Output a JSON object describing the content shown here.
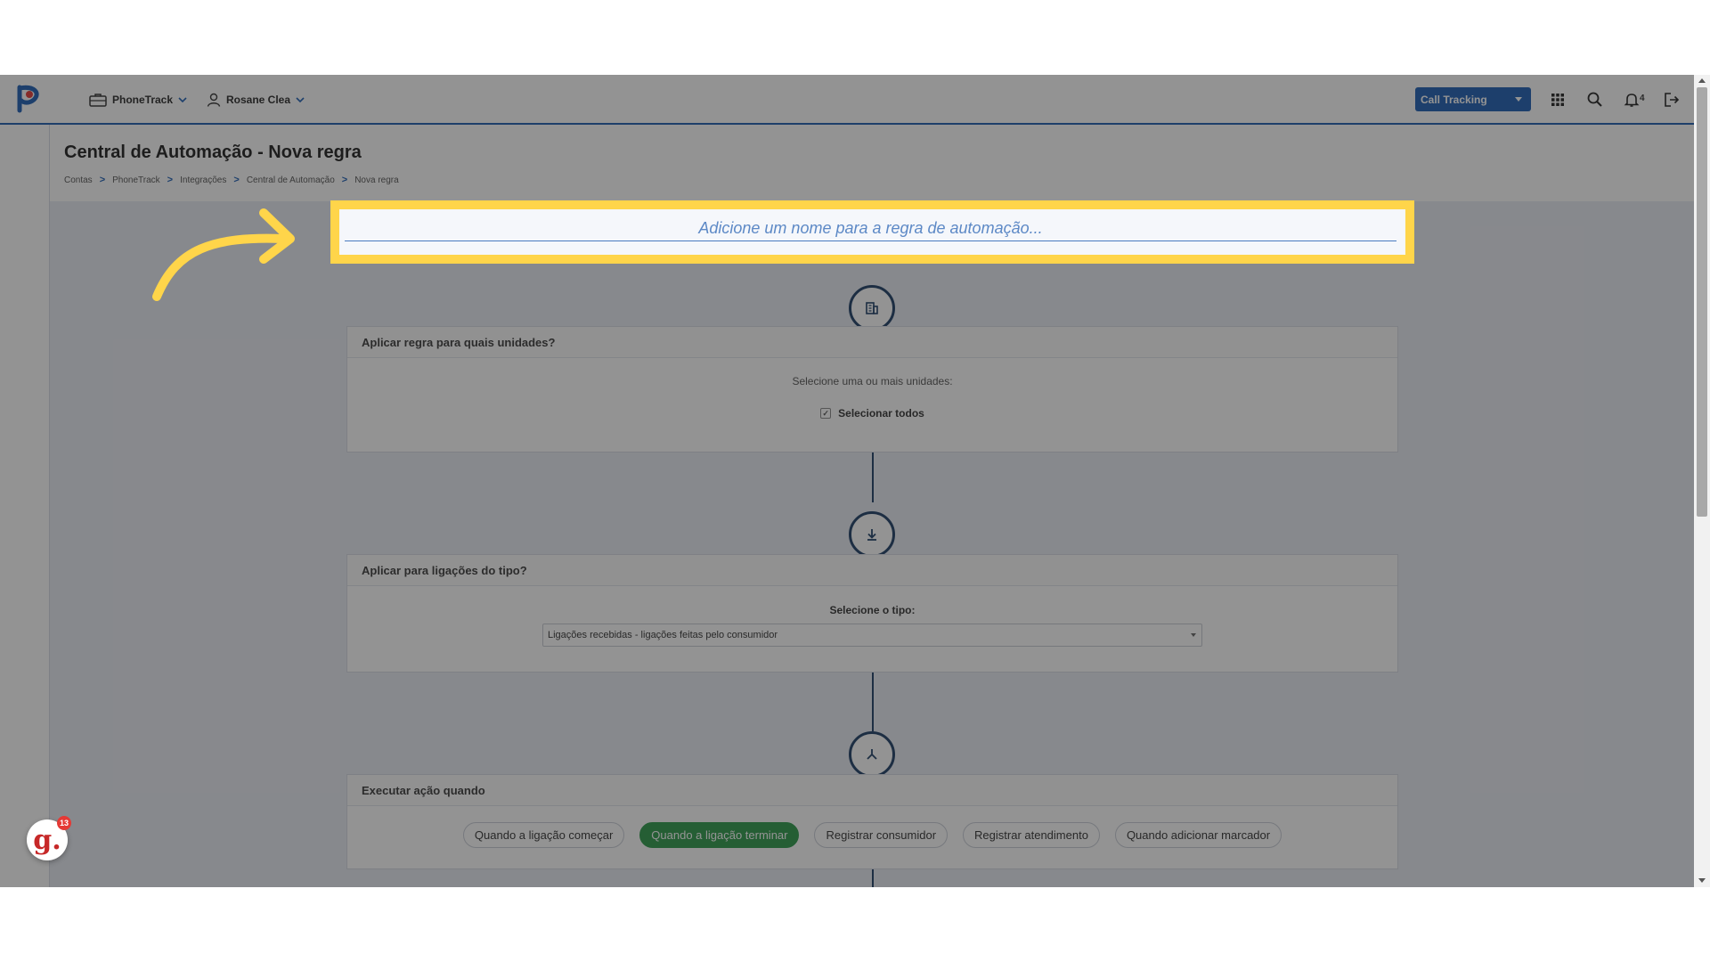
{
  "nav": {
    "account": "PhoneTrack",
    "user": "Rosane Clea",
    "product_button": "Call Tracking",
    "notifications_count": "4",
    "icons": [
      "apps-grid-icon",
      "search-icon",
      "bell-icon",
      "logout-icon"
    ]
  },
  "header": {
    "title": "Central de Automação - Nova regra",
    "breadcrumb": [
      "Contas",
      "PhoneTrack",
      "Integrações",
      "Central de Automação",
      "Nova regra"
    ],
    "breadcrumb_separator": ">"
  },
  "rule_name": {
    "placeholder": "Adicione um nome para a regra de automação...",
    "value": ""
  },
  "units_card": {
    "title": "Aplicar regra para quais unidades?",
    "hint": "Selecione uma ou mais unidades:",
    "select_all_label": "Selecionar todos",
    "select_all_checked": true
  },
  "call_type_card": {
    "title": "Aplicar para ligações do tipo?",
    "hint": "Selecione o tipo:",
    "selected": "Ligações recebidas - ligações feitas pelo consumidor"
  },
  "action_card": {
    "title": "Executar ação quando",
    "options": [
      "Quando a ligação começar",
      "Quando a ligação terminar",
      "Registrar consumidor",
      "Registrar atendimento",
      "Quando adicionar marcador"
    ],
    "active_index": 1
  },
  "help_widget": {
    "glyph": "g.",
    "badge": "13"
  },
  "colors": {
    "brand_blue": "#1e5fb4",
    "highlight_yellow": "#ffd54a",
    "active_green": "#2c9a4a",
    "step_navy": "#1d3f66"
  }
}
